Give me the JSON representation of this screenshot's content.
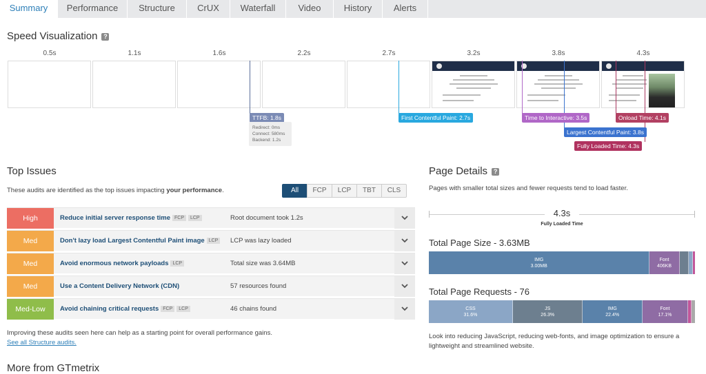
{
  "tabs": [
    "Summary",
    "Performance",
    "Structure",
    "CrUX",
    "Waterfall",
    "Video",
    "History",
    "Alerts"
  ],
  "speed": {
    "title": "Speed Visualization",
    "help": "?",
    "times": [
      "0.5s",
      "1.1s",
      "1.6s",
      "2.2s",
      "2.7s",
      "3.2s",
      "3.8s",
      "4.3s"
    ],
    "ttfb": {
      "label": "TTFB: 1.8s",
      "redirect": "Redirect: 0ms",
      "connect": "Connect: 580ms",
      "backend": "Backend: 1.2s"
    },
    "fcp": "First Contentful Paint: 2.7s",
    "tti": "Time to Interactive: 3.5s",
    "onload": "Onload Time: 4.1s",
    "lcp": "Largest Contentful Paint: 3.8s",
    "fully": "Fully Loaded Time: 4.3s"
  },
  "issues": {
    "title": "Top Issues",
    "desc_pre": "These audits are identified as the top issues impacting ",
    "desc_bold": "your performance",
    "desc_post": ".",
    "filters": [
      "All",
      "FCP",
      "LCP",
      "TBT",
      "CLS"
    ],
    "rows": [
      {
        "sev": "High",
        "color": "#ec6e63",
        "title": "Reduce initial server response time",
        "tags": [
          "FCP",
          "LCP"
        ],
        "desc": "Root document took 1.2s"
      },
      {
        "sev": "Med",
        "color": "#f3a94a",
        "title": "Don't lazy load Largest Contentful Paint image",
        "tags": [
          "LCP"
        ],
        "desc": "LCP was lazy loaded"
      },
      {
        "sev": "Med",
        "color": "#f3a94a",
        "title": "Avoid enormous network payloads",
        "tags": [
          "LCP"
        ],
        "desc": "Total size was 3.64MB"
      },
      {
        "sev": "Med",
        "color": "#f3a94a",
        "title": "Use a Content Delivery Network (CDN)",
        "tags": [],
        "desc": "57 resources found"
      },
      {
        "sev": "Med-Low",
        "color": "#8fbd4a",
        "title": "Avoid chaining critical requests",
        "tags": [
          "FCP",
          "LCP"
        ],
        "desc": "46 chains found"
      }
    ],
    "footer": "Improving these audits seen here can help as a starting point for overall performance gains.",
    "link": "See all Structure audits."
  },
  "more": "More from GTmetrix",
  "details": {
    "title": "Page Details",
    "help": "?",
    "desc": "Pages with smaller total sizes and fewer requests tend to load faster.",
    "fully_value": "4.3s",
    "fully_label": "Fully Loaded Time",
    "size_title": "Total Page Size - 3.63MB",
    "size_segs": [
      {
        "name": "IMG",
        "value": "3.00MB",
        "share": 0.83,
        "color": "#5a82aa"
      },
      {
        "name": "Font",
        "value": "406KB",
        "share": 0.112,
        "color": "#8f6ca4"
      },
      {
        "name": "",
        "value": "",
        "share": 0.035,
        "color": "#6d7f8f"
      },
      {
        "name": "",
        "value": "",
        "share": 0.015,
        "color": "#8ba6c6"
      },
      {
        "name": "",
        "value": "",
        "share": 0.008,
        "color": "#c2569a"
      }
    ],
    "req_title": "Total Page Requests - 76",
    "req_segs": [
      {
        "name": "CSS",
        "value": "31.6%",
        "share": 0.316,
        "color": "#8ba6c6"
      },
      {
        "name": "JS",
        "value": "26.3%",
        "share": 0.263,
        "color": "#6d7f8f"
      },
      {
        "name": "IMG",
        "value": "22.4%",
        "share": 0.224,
        "color": "#5a82aa"
      },
      {
        "name": "Font",
        "value": "17.1%",
        "share": 0.171,
        "color": "#8f6ca4"
      },
      {
        "name": "",
        "value": "",
        "share": 0.013,
        "color": "#c2569a"
      },
      {
        "name": "",
        "value": "",
        "share": 0.013,
        "color": "#aaaaaa"
      }
    ],
    "footer": "Look into reducing JavaScript, reducing web-fonts, and image optimization to ensure a lightweight and streamlined website."
  }
}
